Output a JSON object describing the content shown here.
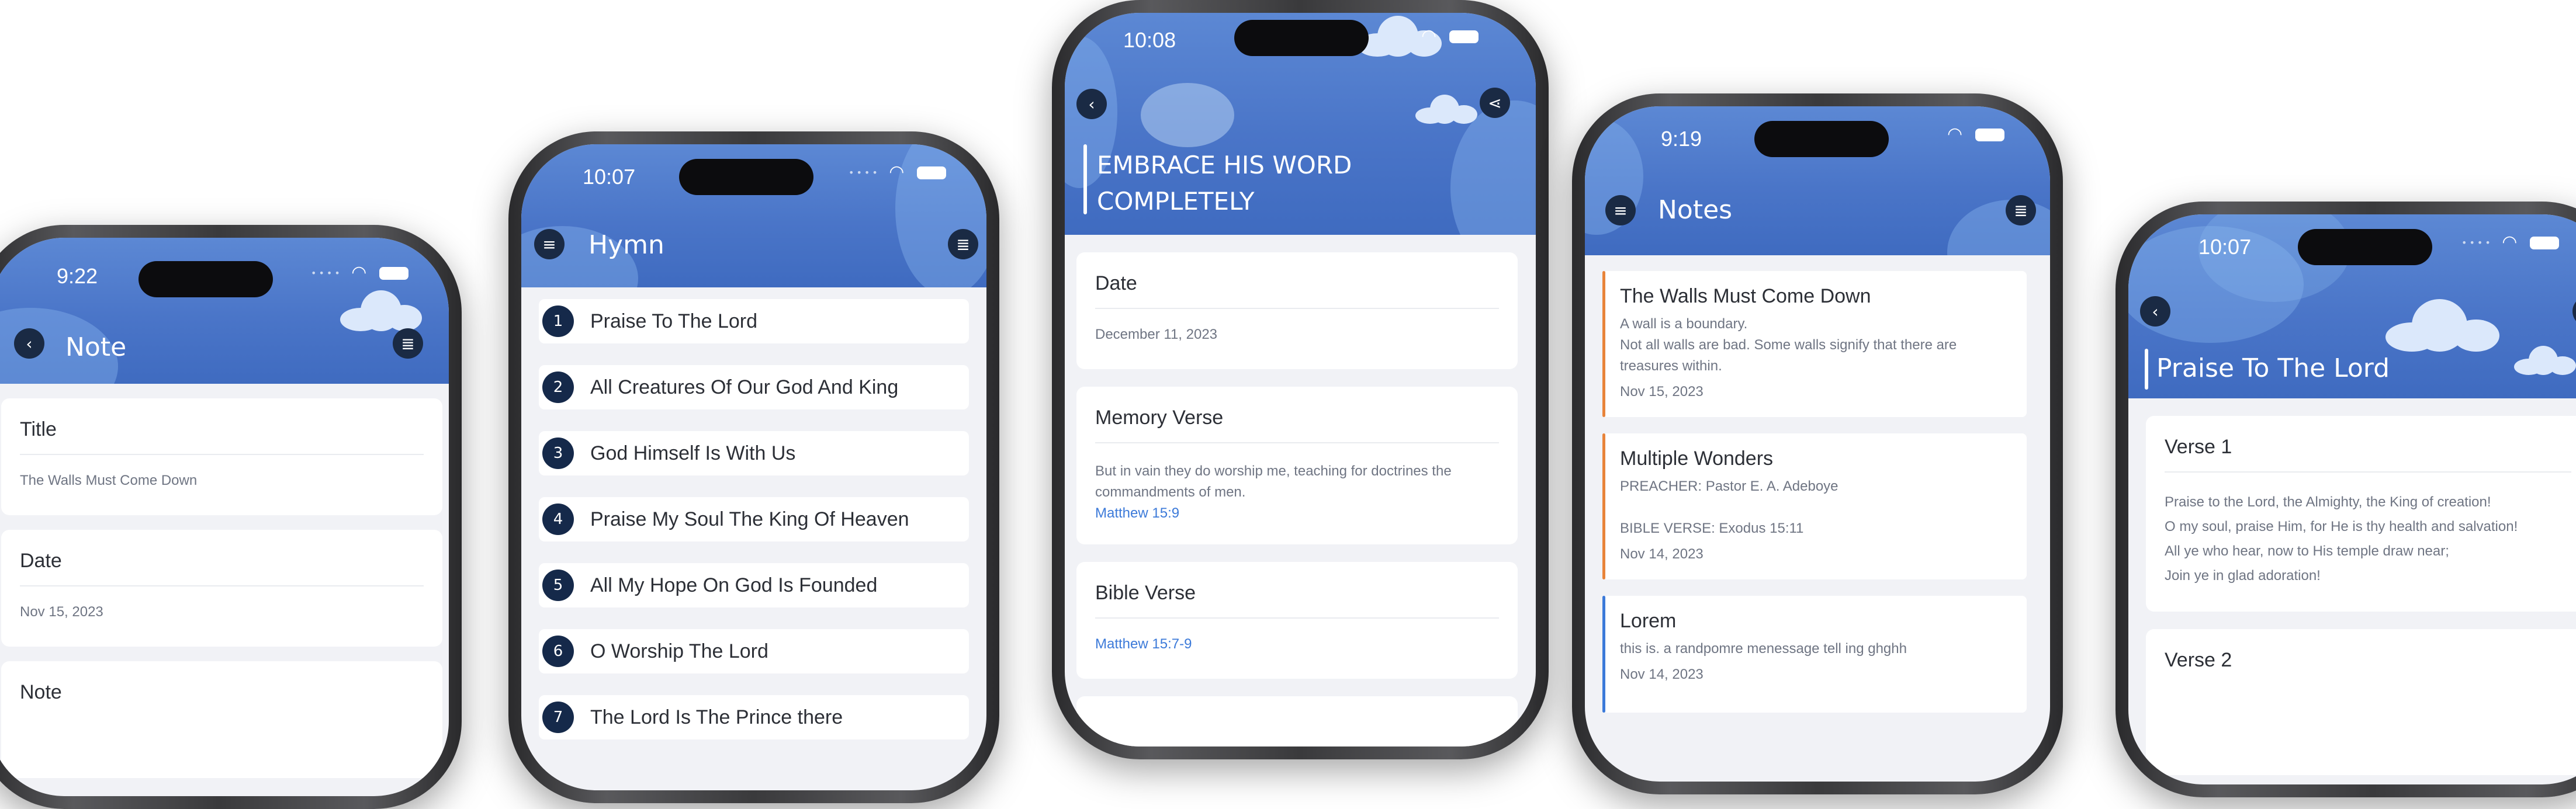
{
  "colors": {
    "header_blue": "#4a75c8",
    "accent_orange": "#e8843a",
    "accent_blue": "#3c7ad9",
    "link": "#3c7ad9",
    "badge": "#15294a"
  },
  "phone1": {
    "time": "9:22",
    "title": "Note",
    "back_icon": "chevron-left-icon",
    "menu_icon": "list-icon",
    "fields": [
      {
        "label": "Title",
        "value": "The Walls Must Come Down"
      },
      {
        "label": "Date",
        "value": "Nov 15, 2023"
      },
      {
        "label": "Note",
        "value": ""
      }
    ]
  },
  "phone2": {
    "time": "10:07",
    "title": "Hymn",
    "hymns": [
      {
        "num": "1",
        "title": "Praise To The Lord"
      },
      {
        "num": "2",
        "title": "All Creatures Of Our God And King"
      },
      {
        "num": "3",
        "title": "God Himself Is With Us"
      },
      {
        "num": "4",
        "title": "Praise My Soul The King Of Heaven"
      },
      {
        "num": "5",
        "title": "All My Hope On God Is Founded"
      },
      {
        "num": "6",
        "title": "O Worship The Lord"
      },
      {
        "num": "7",
        "title": "The Lord Is The Prince there"
      }
    ]
  },
  "phone3": {
    "time": "10:08",
    "title_line1": "EMBRACE HIS WORD",
    "title_line2": "COMPLETELY",
    "date_label": "Date",
    "date_value": "December 11, 2023",
    "memory_label": "Memory Verse",
    "memory_text_1": "But in vain they do worship me, teaching for doctrines the",
    "memory_text_2": "commandments of men.",
    "memory_ref": "Matthew 15:9",
    "bible_label": "Bible Verse",
    "bible_ref": "Matthew 15:7-9"
  },
  "phone4": {
    "time": "9:19",
    "title": "Notes",
    "notes": [
      {
        "title": "The Walls Must Come Down",
        "line1": "A wall is a boundary.",
        "line2": "Not all walls are bad. Some walls signify that there are",
        "line3": "treasures within.",
        "date": "Nov 15, 2023"
      },
      {
        "title": "Multiple Wonders",
        "line1": "PREACHER: Pastor E. A. Adeboye",
        "line2": "",
        "line3": "BIBLE VERSE: Exodus 15:11",
        "date": "Nov 14, 2023"
      },
      {
        "title": "Lorem",
        "line1": "this is. a randpomre menessage tell ing ghghh",
        "date": "Nov 14, 2023"
      }
    ]
  },
  "phone5": {
    "time": "10:07",
    "title": "Praise To The Lord",
    "verse1_label": "Verse 1",
    "verse1_lines": [
      "Praise to the Lord, the Almighty, the King of creation!",
      "O my soul, praise Him, for He is thy health and salvation!",
      "All ye who hear, now to His temple draw near;",
      "Join ye in glad adoration!"
    ],
    "verse2_label": "Verse 2"
  }
}
